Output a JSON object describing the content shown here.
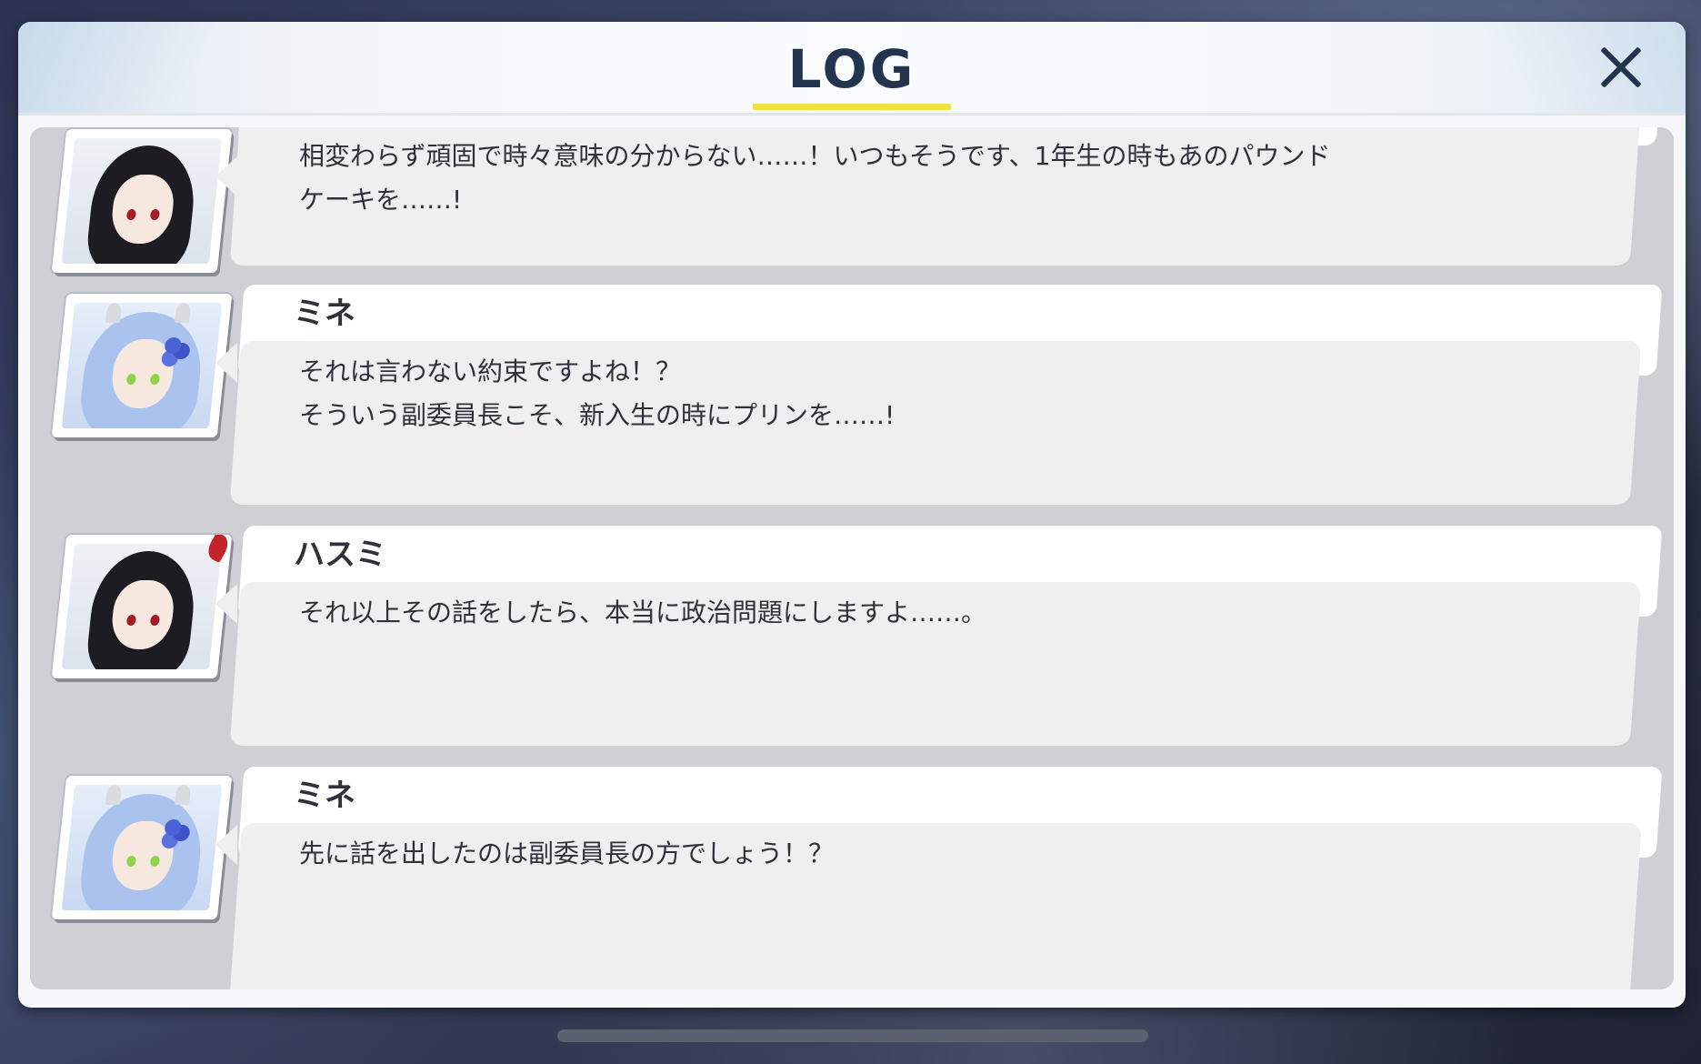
{
  "header": {
    "title": "LOG",
    "close_label": "close-log"
  },
  "colors": {
    "title_text": "#23344f",
    "title_underline": "#f3e23c",
    "bubble_bg": "#efefef",
    "name_tab_bg": "#ffffff",
    "log_area_bg": "#cfd0d3"
  },
  "entries": [
    {
      "speaker": "",
      "avatar": "hasumi-portrait",
      "text": "相変わらず頑固で時々意味の分からない……！いつもそうです、1年生の時もあのパウンド\nケーキを……!"
    },
    {
      "speaker": "ミネ",
      "avatar": "mine-portrait",
      "text": "それは言わない約束ですよね！？\nそういう副委員長こそ、新入生の時にプリンを……!"
    },
    {
      "speaker": "ハスミ",
      "avatar": "hasumi-portrait",
      "text": "それ以上その話をしたら、本当に政治問題にしますよ……。"
    },
    {
      "speaker": "ミネ",
      "avatar": "mine-portrait",
      "text": "先に話を出したのは副委員長の方でしょう！？"
    }
  ]
}
